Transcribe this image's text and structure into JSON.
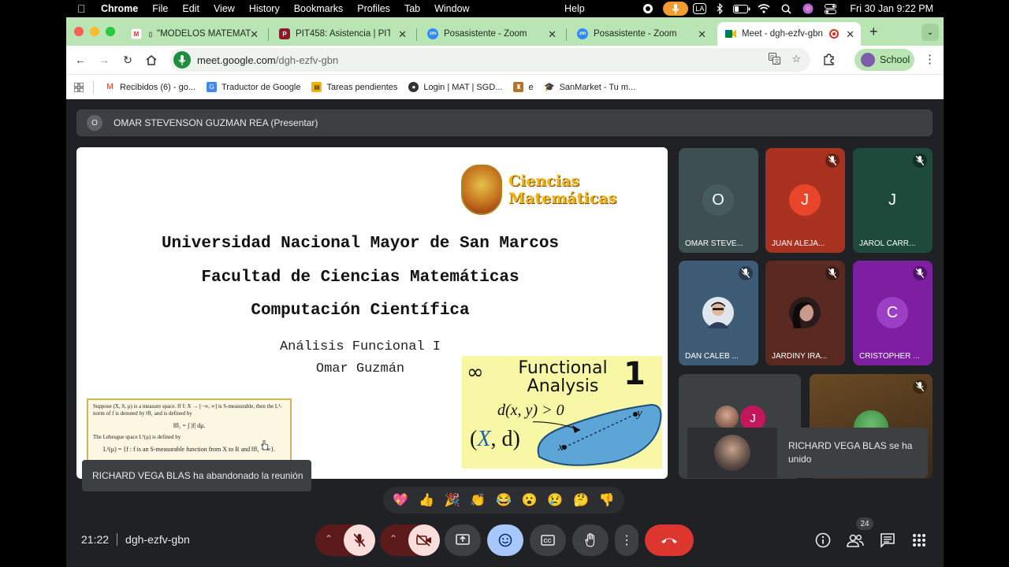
{
  "menubar": {
    "items": [
      "Chrome",
      "File",
      "Edit",
      "View",
      "History",
      "Bookmarks",
      "Profiles",
      "Tab",
      "Window"
    ],
    "help": "Help",
    "input_badge": "LA",
    "datetime": "Fri 30 Jan  9:22 PM"
  },
  "tabs": [
    {
      "title": "\"MODELOS MATEMATICOS",
      "favicon": "gmail-icon"
    },
    {
      "title": "PIT458: Asistencia | PITVIRTUAL",
      "favicon": "pit-icon"
    },
    {
      "title": "Posasistente - Zoom",
      "favicon": "zoom-icon"
    },
    {
      "title": "Posasistente - Zoom",
      "favicon": "zoom-icon"
    },
    {
      "title": "Meet - dgh-ezfv-gbn",
      "favicon": "meet-icon"
    }
  ],
  "address": {
    "host": "meet.google.com",
    "path": "/dgh-ezfv-gbn"
  },
  "profile": {
    "label": "School"
  },
  "bookmarks": [
    {
      "label": "Recibidos (6) - go...",
      "icon": "gmail-icon"
    },
    {
      "label": "Traductor de Google",
      "icon": "translate-icon"
    },
    {
      "label": "Tareas pendientes",
      "icon": "tasks-icon"
    },
    {
      "label": "Login | MAT | SGD...",
      "icon": "user-icon"
    },
    {
      "label": "e",
      "icon": "crest-icon"
    },
    {
      "label": "SanMarket - Tu m...",
      "icon": "cap-icon"
    }
  ],
  "presenter": {
    "initial": "O",
    "label": "OMAR STEVENSON GUZMAN REA (Presentar)"
  },
  "slide": {
    "logo_line1": "Ciencias",
    "logo_line2": "Matemáticas",
    "title1": "Universidad Nacional Mayor de San Marcos",
    "title2": "Facultad de Ciencias Matemáticas",
    "title3": "Computación Científica",
    "subtitle1": "Análisis Funcional I",
    "subtitle2": "Omar Guzmán",
    "excerpt_p1": "Suppose (X, S, μ) is a measure space. If f: X → [−∞, ∞] is S-measurable, then the L¹-norm of f is denoted by ‖f‖₁ and is defined by",
    "excerpt_eq": "‖f‖₁ = ∫ |f| dμ.",
    "excerpt_p2": "The Lebesgue space L¹(μ) is defined by",
    "excerpt_p3": "L¹(μ) = {f : f is an S-measurable function from X to R and ‖f‖₁ < ∞}.",
    "card_title1": "Functional",
    "card_title2": "Analysis",
    "card_number": "1",
    "card_formula": "d(x, y) > 0",
    "card_space_x": "X",
    "card_space_d": ", d)",
    "card_point_x": "x",
    "card_point_y": "y"
  },
  "participants": [
    {
      "name": "OMAR STEVE...",
      "initial": "O",
      "bg": "#3d4f50",
      "avatar_bg": "#475c5e",
      "muted": false
    },
    {
      "name": "JUAN ALEJA...",
      "initial": "J",
      "bg": "#a8321f",
      "avatar_bg": "#e8452b",
      "muted": true
    },
    {
      "name": "JAROL CARR...",
      "initial": "J",
      "bg": "#1d4a3a",
      "avatar_bg": "#1d4a3a",
      "muted": true
    },
    {
      "name": "DAN CALEB ...",
      "initial": "",
      "bg": "#3f5c76",
      "avatar_bg": "#dfe6ee",
      "muted": true
    },
    {
      "name": "JARDINY IRA...",
      "initial": "",
      "bg": "#5a2a22",
      "avatar_bg": "#2a1c1a",
      "muted": true
    },
    {
      "name": "CRISTOPHER ...",
      "initial": "C",
      "bg": "#7d1fa0",
      "avatar_bg": "#9c3fc4",
      "muted": true
    }
  ],
  "small_tile_initial": "J",
  "toast_left": "RICHARD VEGA BLAS ha abandonado la reunión",
  "toast_right": "RICHARD VEGA BLAS se ha unido",
  "reactions": [
    "💖",
    "👍",
    "🎉",
    "👏",
    "😂",
    "😮",
    "😢",
    "🤔",
    "👎"
  ],
  "meeting": {
    "time": "21:22",
    "code": "dgh-ezfv-gbn",
    "participant_count": "24"
  }
}
